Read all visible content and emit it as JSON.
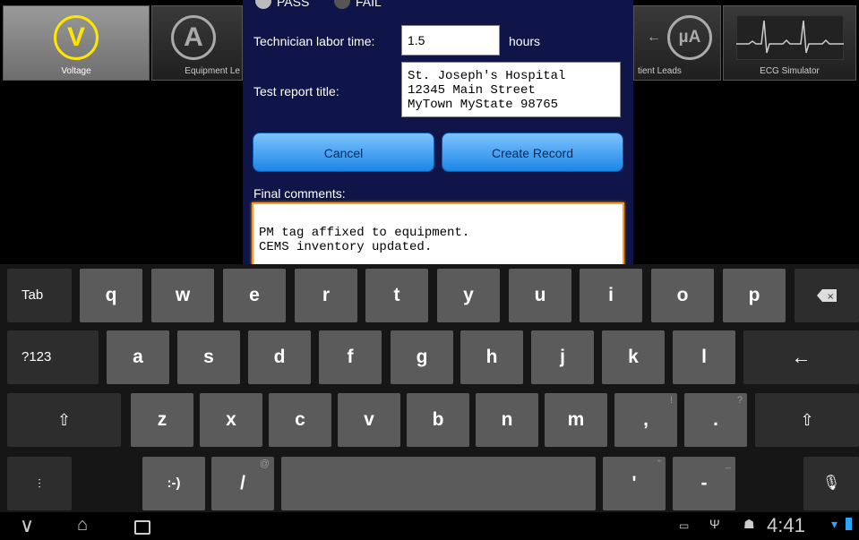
{
  "toolbar": {
    "items": [
      {
        "label": "Voltage",
        "icon_text": "V"
      },
      {
        "label": "Equipment Le",
        "icon_text": "A"
      },
      {
        "label": "tient Leads",
        "icon_text": "µA"
      },
      {
        "label": "ECG Simulator",
        "icon_text": ""
      }
    ]
  },
  "dialog": {
    "pass_label": "PASS",
    "fail_label": "FAIL",
    "labor_label": "Technician labor time:",
    "labor_value": "1.5",
    "labor_unit": "hours",
    "report_title_label": "Test report title:",
    "report_title_value": "St. Joseph's Hospital\n12345 Main Street\nMyTown MyState 98765",
    "cancel_label": "Cancel",
    "create_label": "Create Record",
    "final_comments_label": "Final comments:",
    "final_comments_value": "PM tag affixed to equipment.\nCEMS inventory updated."
  },
  "keyboard": {
    "row1": [
      "Tab",
      "q",
      "w",
      "e",
      "r",
      "t",
      "y",
      "u",
      "i",
      "o",
      "p"
    ],
    "row2": [
      "?123",
      "a",
      "s",
      "d",
      "f",
      "g",
      "h",
      "j",
      "k",
      "l"
    ],
    "row3": [
      "z",
      "x",
      "c",
      "v",
      "b",
      "n",
      "m",
      ",",
      "."
    ],
    "row3_subs": {
      "comma": "!",
      "period": "?"
    },
    "row4": {
      "smiley": ":-)",
      "slash": "/",
      "slash_sub": "@",
      "apostrophe": "'",
      "apostrophe_sub": "\"",
      "dash": "-",
      "dash_sub": "_"
    }
  },
  "statusbar": {
    "time": "4:41"
  }
}
